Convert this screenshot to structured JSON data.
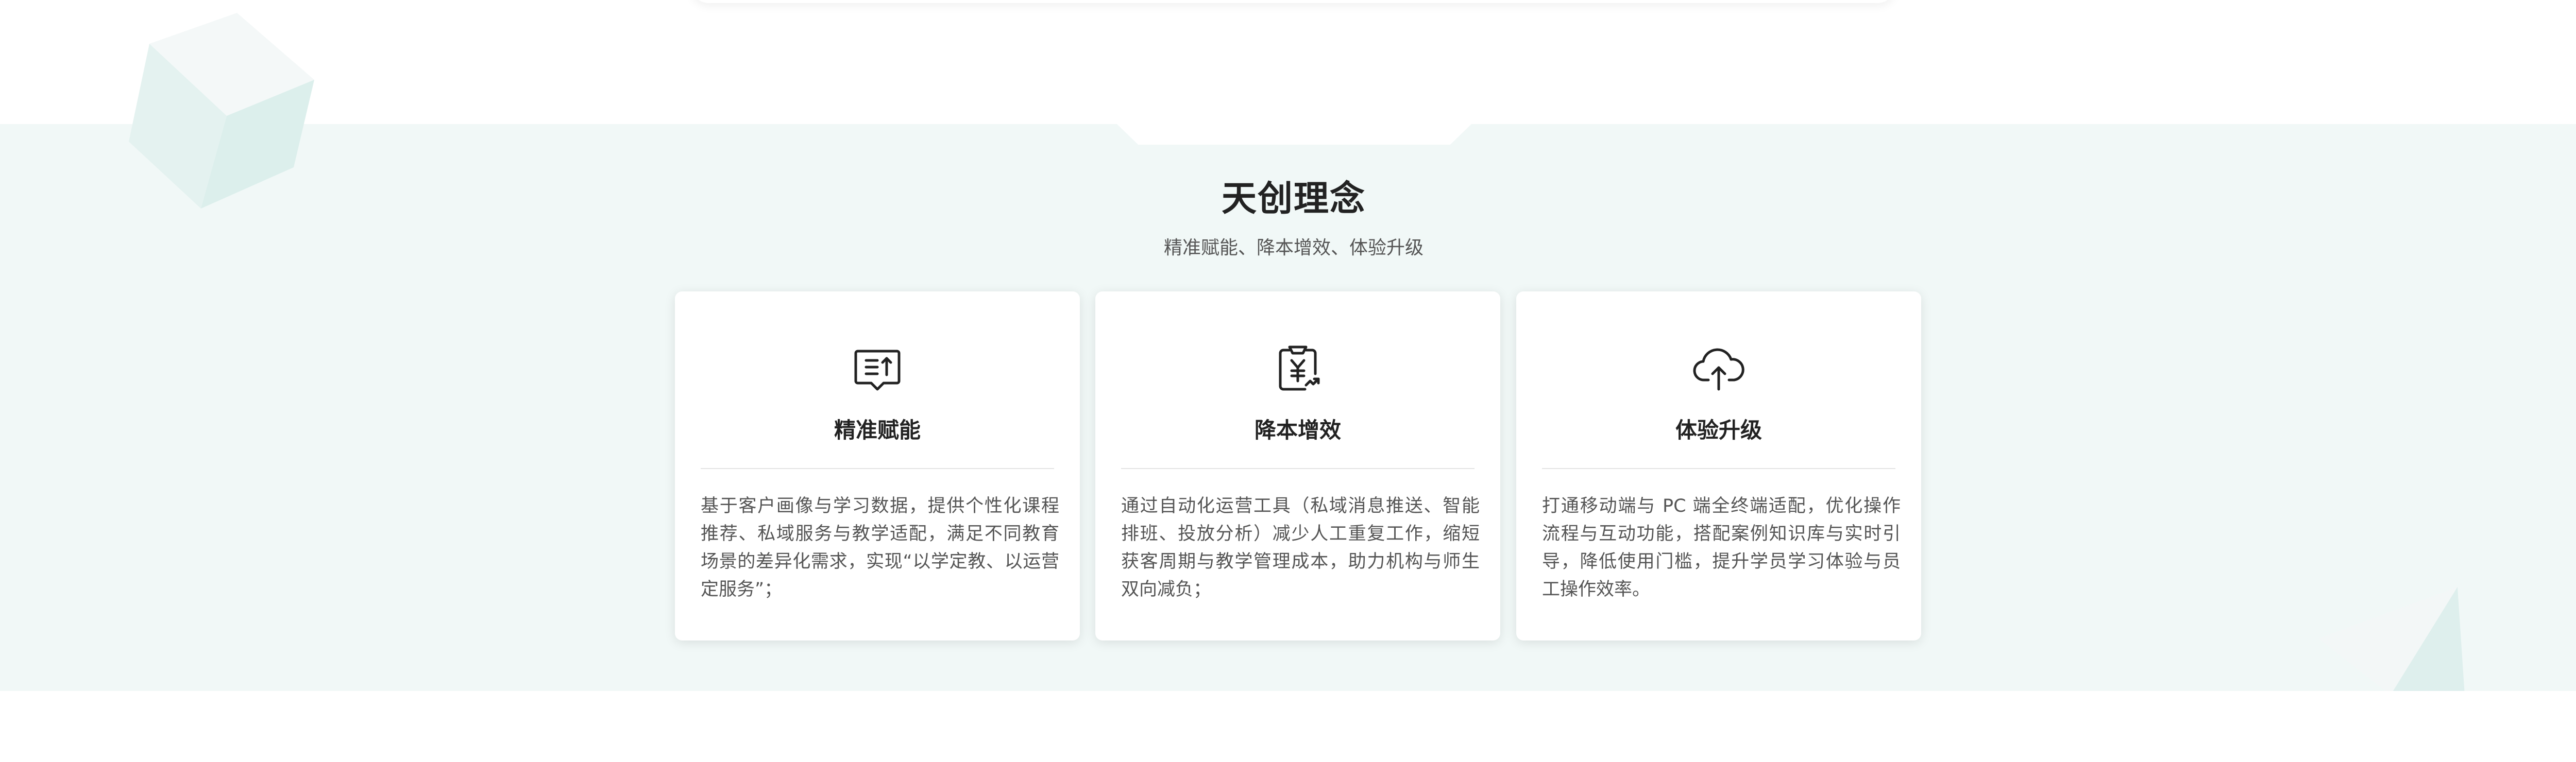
{
  "section": {
    "title": "天创理念",
    "subtitle": "精准赋能、降本增效、体验升级"
  },
  "cards": [
    {
      "icon": "chat-bubble-list-icon",
      "title": "精准赋能",
      "description": "基于客户画像与学习数据，提供个性化课程推荐、私域服务与教学适配，满足不同教育场景的差异化需求，实现“以学定教、以运营定服务”；"
    },
    {
      "icon": "yen-document-icon",
      "title": "降本增效",
      "description": "通过自动化运营工具（私域消息推送、智能排班、投放分析）减少人工重复工作，缩短获客周期与教学管理成本，助力机构与师生双向减负；"
    },
    {
      "icon": "cloud-upload-icon",
      "title": "体验升级",
      "description": "打通移动端与 PC 端全终端适配，优化操作流程与互动功能，搭配案例知识库与实时引导，降低使用门槛，提升学员学习体验与员工操作效率。"
    }
  ],
  "colors": {
    "band_background": "#f1f8f7",
    "card_background": "#ffffff",
    "title_text": "#222222",
    "body_text": "#555555",
    "decor_teal": "#d9efec"
  }
}
